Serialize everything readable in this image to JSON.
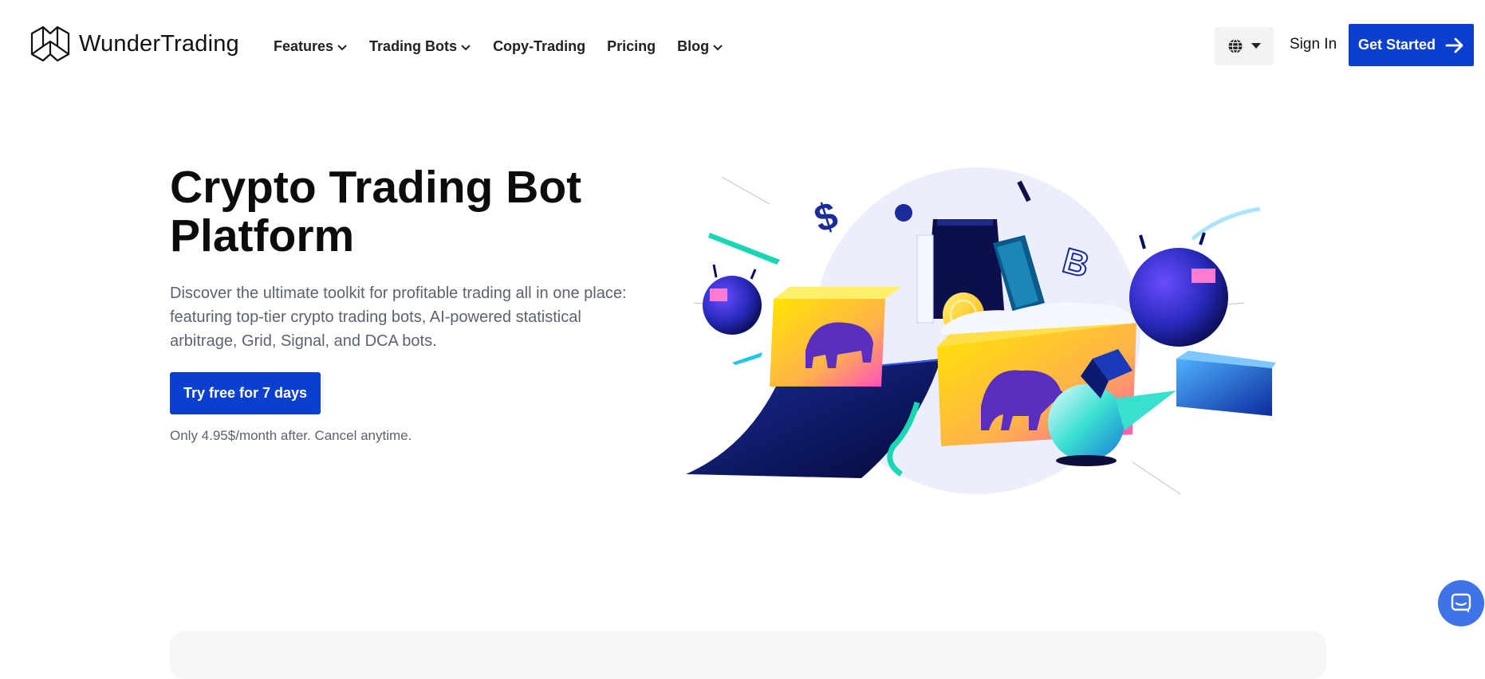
{
  "brand": {
    "name": "WunderTrading",
    "logo_icon": "map-fold-logo"
  },
  "nav": {
    "items": [
      {
        "label": "Features",
        "has_dropdown": true
      },
      {
        "label": "Trading Bots",
        "has_dropdown": true
      },
      {
        "label": "Copy-Trading",
        "has_dropdown": false
      },
      {
        "label": "Pricing",
        "has_dropdown": false
      },
      {
        "label": "Blog",
        "has_dropdown": true
      }
    ]
  },
  "header": {
    "language_icon": "globe-icon",
    "signin_label": "Sign In",
    "get_started_label": "Get Started"
  },
  "hero": {
    "title_line1": "Crypto Trading Bot",
    "title_line2": "Platform",
    "description": "Discover the ultimate toolkit for profitable trading all in one place: featuring top-tier crypto trading bots, AI-powered statistical arbitrage, Grid, Signal, and DCA bots.",
    "cta_label": "Try free for 7 days",
    "price_note": "Only 4.95$/month after. Cancel anytime."
  },
  "colors": {
    "primary": "#0a3fd0",
    "chat": "#3f74e8",
    "text_muted": "#5b6270"
  }
}
